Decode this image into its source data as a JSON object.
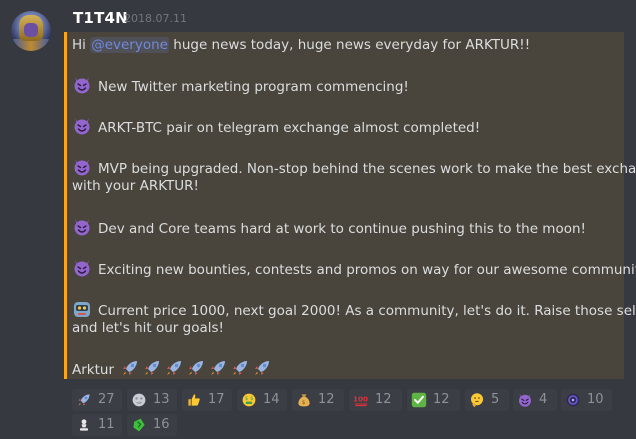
{
  "message": {
    "author": "T1T4N",
    "timestamp": "2018.07.11",
    "line1_prefix": "Hi ",
    "mention": "@everyone",
    "line1_suffix": " huge news today, huge news everyday for ARKTUR!!",
    "item1": "New Twitter marketing program commencing!",
    "item2": "ARKT-BTC pair on telegram exchange almost completed!",
    "item3_a": "MVP being upgraded. Non-stop behind the scenes work to make the best exchange",
    "item3_b": "with your ARKTUR!",
    "item4": "Dev and Core teams hard at work to continue pushing this to the moon!",
    "item5": "Exciting new bounties, contests and promos on way for our awesome community!",
    "item6_a": "Current price 1000, next goal 2000! As a community, let's do it. Raise those sells",
    "item6_b": "and let's hit our goals!",
    "signoff": "Arktur",
    "signoff_icons": [
      "rocket-icon",
      "rocket-icon",
      "rocket-icon",
      "rocket-icon",
      "rocket-icon",
      "rocket-icon",
      "rocket-icon"
    ],
    "highlight_color": "#faa61a"
  },
  "reactions": [
    {
      "icon": "rocket-icon",
      "count": "27"
    },
    {
      "icon": "full-moon-face-icon",
      "count": "13"
    },
    {
      "icon": "thumbs-up-icon",
      "count": "17"
    },
    {
      "icon": "money-mouth-face-icon",
      "count": "14"
    },
    {
      "icon": "money-bag-icon",
      "count": "12"
    },
    {
      "icon": "hundred-points-icon",
      "count": "12"
    },
    {
      "icon": "check-mark-icon",
      "count": "12"
    },
    {
      "icon": "thinking-face-icon",
      "count": "5"
    },
    {
      "icon": "smiling-devil-icon",
      "count": "4"
    },
    {
      "icon": "custom-emoji-icon",
      "count": "10"
    },
    {
      "icon": "chess-pawn-icon",
      "count": "11"
    },
    {
      "icon": "green-token-icon",
      "count": "16"
    }
  ]
}
